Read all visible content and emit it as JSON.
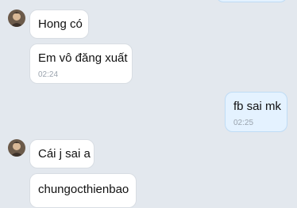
{
  "conversation": {
    "messages": [
      {
        "direction": "incoming",
        "text": "Hong có",
        "time": ""
      },
      {
        "direction": "incoming",
        "text": "Em vô đăng xuất",
        "time": "02:24"
      },
      {
        "direction": "outgoing",
        "text": "fb sai mk",
        "time": "02:25"
      },
      {
        "direction": "incoming",
        "text": "Cái j sai a",
        "time": ""
      },
      {
        "direction": "incoming",
        "text": "chungocthienbao",
        "time": ""
      }
    ]
  },
  "avatar_icon": "user-avatar-icon",
  "colors": {
    "background": "#e3e8ee",
    "incoming_bubble": "#ffffff",
    "outgoing_bubble": "#e4f2ff",
    "time_text": "#9aa3ad"
  }
}
